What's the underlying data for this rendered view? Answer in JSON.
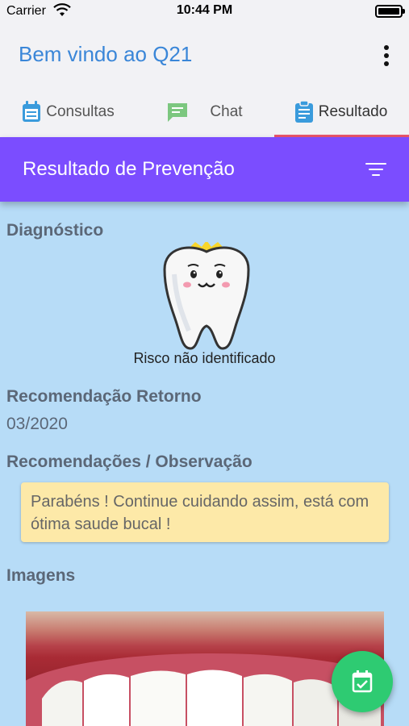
{
  "status_bar": {
    "carrier": "Carrier",
    "time": "10:44 PM"
  },
  "app_bar": {
    "title": "Bem vindo ao Q21",
    "menu_icon": "more-vert-icon"
  },
  "tabs": [
    {
      "label": "Consultas",
      "icon": "calendar-icon",
      "active": false
    },
    {
      "label": "Chat",
      "icon": "chat-icon",
      "active": false
    },
    {
      "label": "Resultado",
      "icon": "clipboard-icon",
      "active": true
    }
  ],
  "section": {
    "title": "Resultado de Prevenção",
    "filter_icon": "filter-icon"
  },
  "content": {
    "diagnostico_label": "Diagnóstico",
    "risk_text": "Risco não identificado",
    "retorno_label": "Recomendação Retorno",
    "retorno_value": "03/2020",
    "observacao_label": "Recomendações / Observação",
    "observacao_text": "Parabéns ! Continue cuidando assim, está com ótima saude bucal !",
    "imagens_label": "Imagens"
  },
  "colors": {
    "accent": "#3a86d8",
    "header": "#7b4dff",
    "tab_indicator": "#e9556a",
    "content_bg": "#b7dcf7",
    "note_bg": "#fde9a8",
    "fab": "#2ecb72"
  },
  "fab": {
    "icon": "calendar-check-icon"
  }
}
